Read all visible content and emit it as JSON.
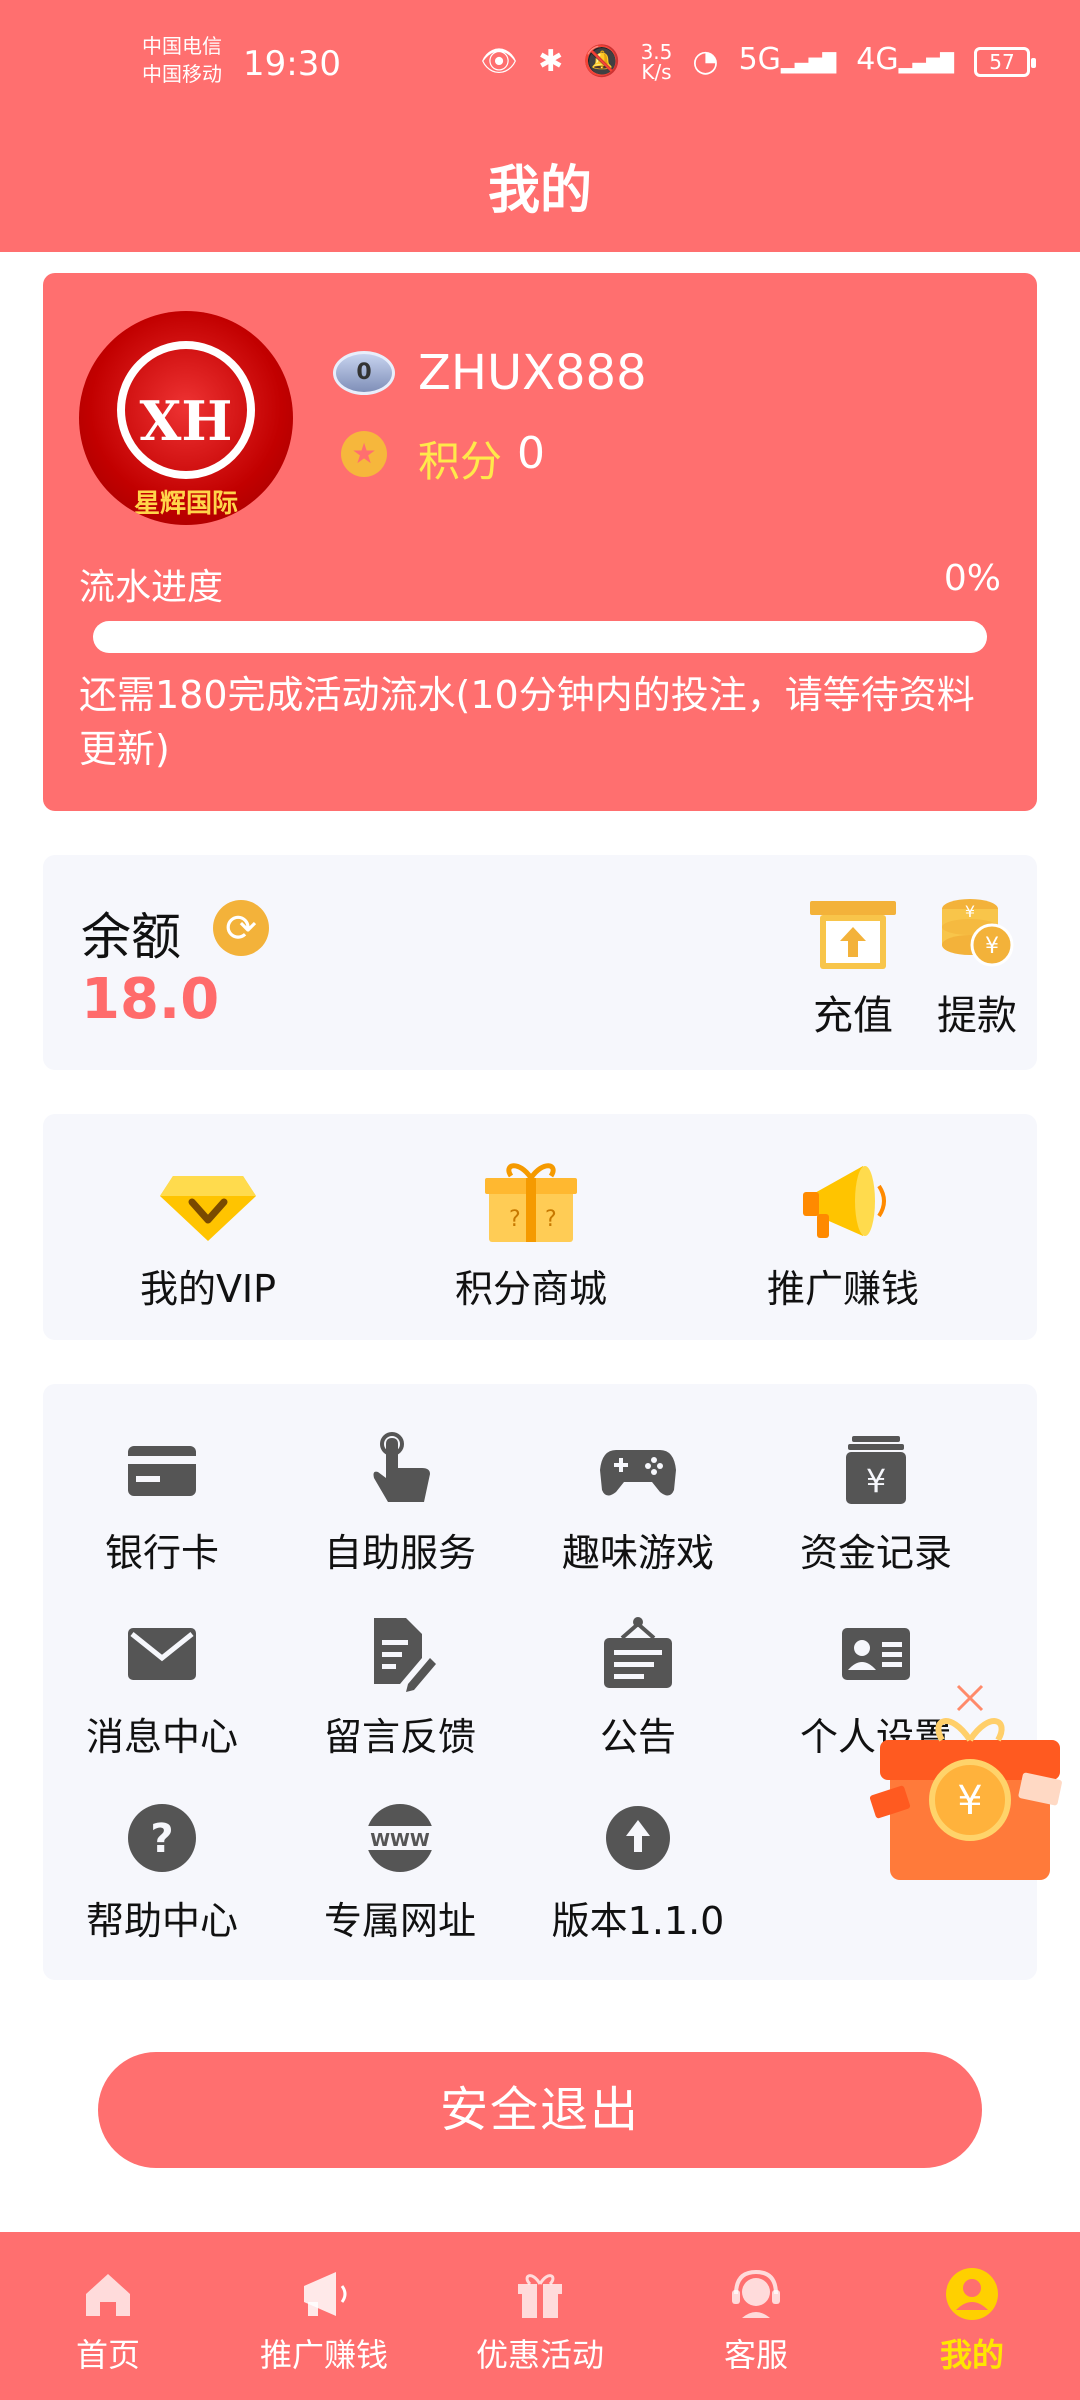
{
  "status_bar": {
    "carrier_1": "中国电信",
    "carrier_2": "中国移动",
    "time": "19:30",
    "speed": "3.5\nK/s",
    "signal_1": "5G",
    "signal_2": "4G",
    "battery": "57"
  },
  "header": {
    "title": "我的"
  },
  "profile": {
    "avatar_mark": "XH",
    "avatar_tag": "星辉国际",
    "level": "0",
    "username": "ZHUX888",
    "points_label": "积分",
    "points_value": "0",
    "flow_label": "流水进度",
    "flow_percent": "0%",
    "flow_progress": 0,
    "flow_note": "还需180完成活动流水(10分钟内的投注，请等待资料更新)"
  },
  "balance": {
    "label": "余额",
    "value": "18.0",
    "recharge_label": "充值",
    "withdraw_label": "提款"
  },
  "features": [
    {
      "label": "我的VIP",
      "icon": "vip-diamond-icon"
    },
    {
      "label": "积分商城",
      "icon": "points-mall-gift-icon"
    },
    {
      "label": "推广赚钱",
      "icon": "megaphone-icon"
    }
  ],
  "grid": [
    {
      "label": "银行卡",
      "icon": "bank-card-icon"
    },
    {
      "label": "自助服务",
      "icon": "hand-tap-icon"
    },
    {
      "label": "趣味游戏",
      "icon": "gamepad-icon"
    },
    {
      "label": "资金记录",
      "icon": "fund-record-icon"
    },
    {
      "label": "消息中心",
      "icon": "mail-icon"
    },
    {
      "label": "留言反馈",
      "icon": "feedback-icon"
    },
    {
      "label": "公告",
      "icon": "notice-board-icon"
    },
    {
      "label": "个人设置",
      "icon": "id-card-icon"
    },
    {
      "label": "帮助中心",
      "icon": "help-icon"
    },
    {
      "label": "专属网址",
      "icon": "www-globe-icon"
    },
    {
      "label": "版本1.1.0",
      "icon": "upload-arrow-icon"
    }
  ],
  "logout": {
    "label": "安全退出"
  },
  "nav": [
    {
      "label": "首页",
      "icon": "home-icon"
    },
    {
      "label": "推广赚钱",
      "icon": "megaphone-icon"
    },
    {
      "label": "优惠活动",
      "icon": "gift-icon"
    },
    {
      "label": "客服",
      "icon": "headset-icon"
    },
    {
      "label": "我的",
      "icon": "user-icon",
      "active": true
    }
  ],
  "colors": {
    "primary": "#ff6f6f",
    "accent_yellow": "#ffe600",
    "card_bg": "#f6f7fc",
    "icon_gray": "#555555",
    "gold": "#f3b23a"
  }
}
